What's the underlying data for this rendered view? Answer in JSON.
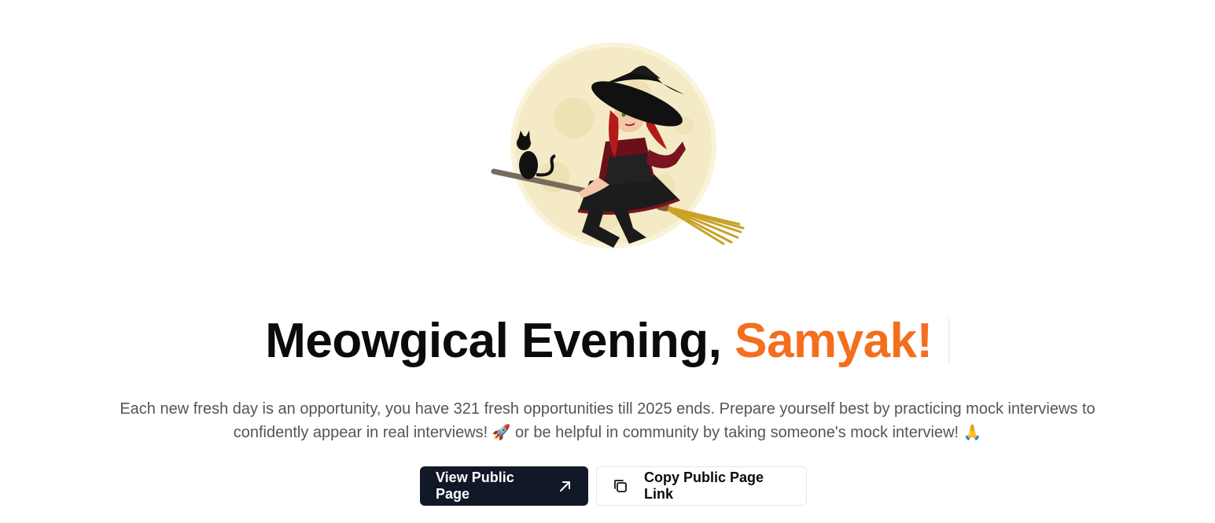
{
  "greeting": {
    "prefix": "Meowgical Evening, ",
    "name": "Samyak!"
  },
  "subtext": {
    "line1": "Each new fresh day is an opportunity, you have 321 fresh opportunities till 2025 ends. Prepare yourself best by practicing mock interviews to",
    "line2_start": "confidently appear in real interviews! ",
    "line2_mid": " or be helpful in community by taking someone's mock interview! ",
    "emoji_rocket": "🚀",
    "emoji_pray": "🙏"
  },
  "actions": {
    "view_public_page": "View Public Page",
    "copy_public_link": "Copy Public Page Link"
  },
  "icons": {
    "view_public_page": "arrow-up-right-icon",
    "copy_public_link": "copy-icon",
    "hero": "witch-on-broom-illustration"
  },
  "colors": {
    "accent": "#f36f1e",
    "primary_button": "#111827",
    "moon": "#f3e8bd"
  }
}
